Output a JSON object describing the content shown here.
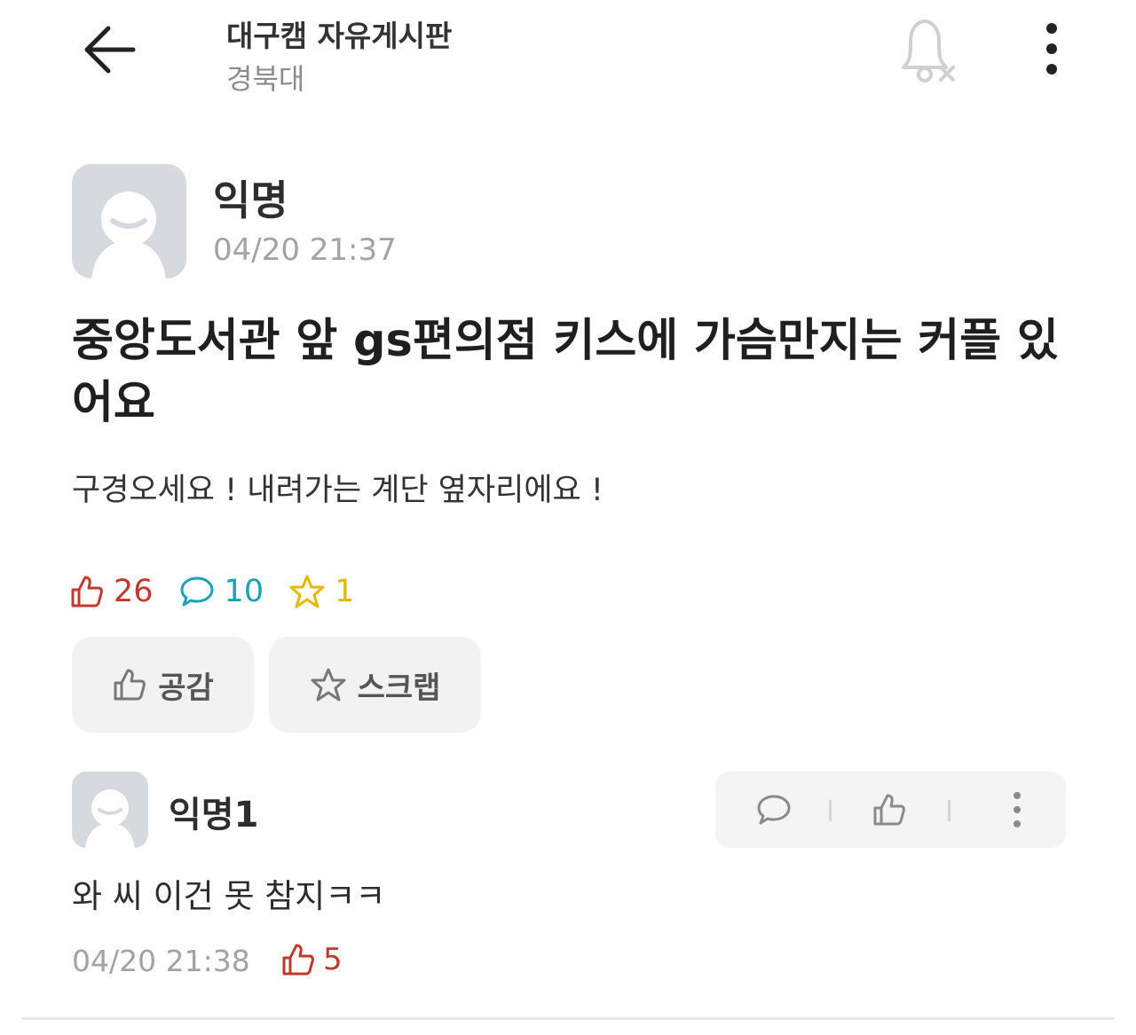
{
  "header": {
    "board_title": "대구캠 자유게시판",
    "school": "경북대",
    "back_icon": "arrow-left-icon",
    "notification_icon": "bell-off-icon",
    "more_icon": "vertical-dots-icon"
  },
  "post": {
    "author": "익명",
    "time": "04/20 21:37",
    "title": "중앙도서관 앞 gs편의점 키스에 가슴만지는 커플 있어요",
    "body": "구경오세요 ! 내려가는 계단 옆자리에요 !",
    "like_count": "26",
    "comment_count": "10",
    "scrap_count": "1",
    "like_button_label": "공감",
    "scrap_button_label": "스크랩"
  },
  "comment": {
    "author": "익명1",
    "text": "와 씨 이건 못 참지ㅋㅋ",
    "time": "04/20 21:38",
    "like_count": "5"
  },
  "colors": {
    "like": "#c0392b",
    "comment": "#1ea0b8",
    "scrap": "#e6b800",
    "muted": "#a3a3a3"
  }
}
